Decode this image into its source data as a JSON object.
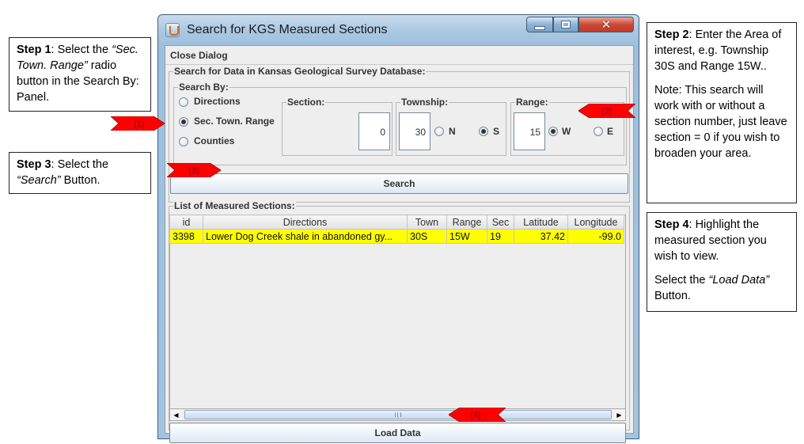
{
  "window": {
    "title": "Search for KGS Measured Sections",
    "menu_close": "Close Dialog",
    "search_panel_title": "Search for Data in Kansas Geological Survey Database:",
    "search_by": {
      "title": "Search By:",
      "options": [
        "Directions",
        "Sec. Town. Range",
        "Counties"
      ],
      "selected": "Sec. Town. Range"
    },
    "section": {
      "label": "Section:",
      "value": "0"
    },
    "township": {
      "label": "Township:",
      "value": "30",
      "options": [
        "N",
        "S"
      ],
      "selected": "S"
    },
    "range": {
      "label": "Range:",
      "value": "15",
      "options": [
        "W",
        "E"
      ],
      "selected": "W"
    },
    "search_button": "Search",
    "list_title": "List of Measured Sections:",
    "table": {
      "columns": [
        "id",
        "Directions",
        "Town",
        "Range",
        "Sec",
        "Latitude",
        "Longitude"
      ],
      "rows": [
        [
          "3398",
          "Lower Dog Creek shale in abandoned gy...",
          "30S",
          "15W",
          "19",
          "37.42",
          "-99.0"
        ]
      ]
    },
    "load_button": "Load Data"
  },
  "markers": [
    "(1)",
    "(2)",
    "(3)",
    "(4)"
  ],
  "marker_color": "#ff0000",
  "callouts": {
    "step1": {
      "lead": "Step 1",
      "rest1": ": Select the ",
      "em": "“Sec. Town. Range”",
      "rest2": " radio button in the Search By: Panel."
    },
    "step2": {
      "lead": "Step 2",
      "rest": ": Enter the Area of interest, e.g. Township 30S and Range 15W..",
      "note": "Note: This search will work with or without a section number, just leave section = 0 if you wish to broaden your area."
    },
    "step3": {
      "lead": "Step 3",
      "rest1": ": Select the ",
      "em": "“Search”",
      "rest2": " Button."
    },
    "step4": {
      "lead": "Step 4",
      "rest": ": Highlight the measured section you wish to view.",
      "p2a": "Select the ",
      "em": "“Load Data”",
      "p2b": " Button."
    }
  }
}
